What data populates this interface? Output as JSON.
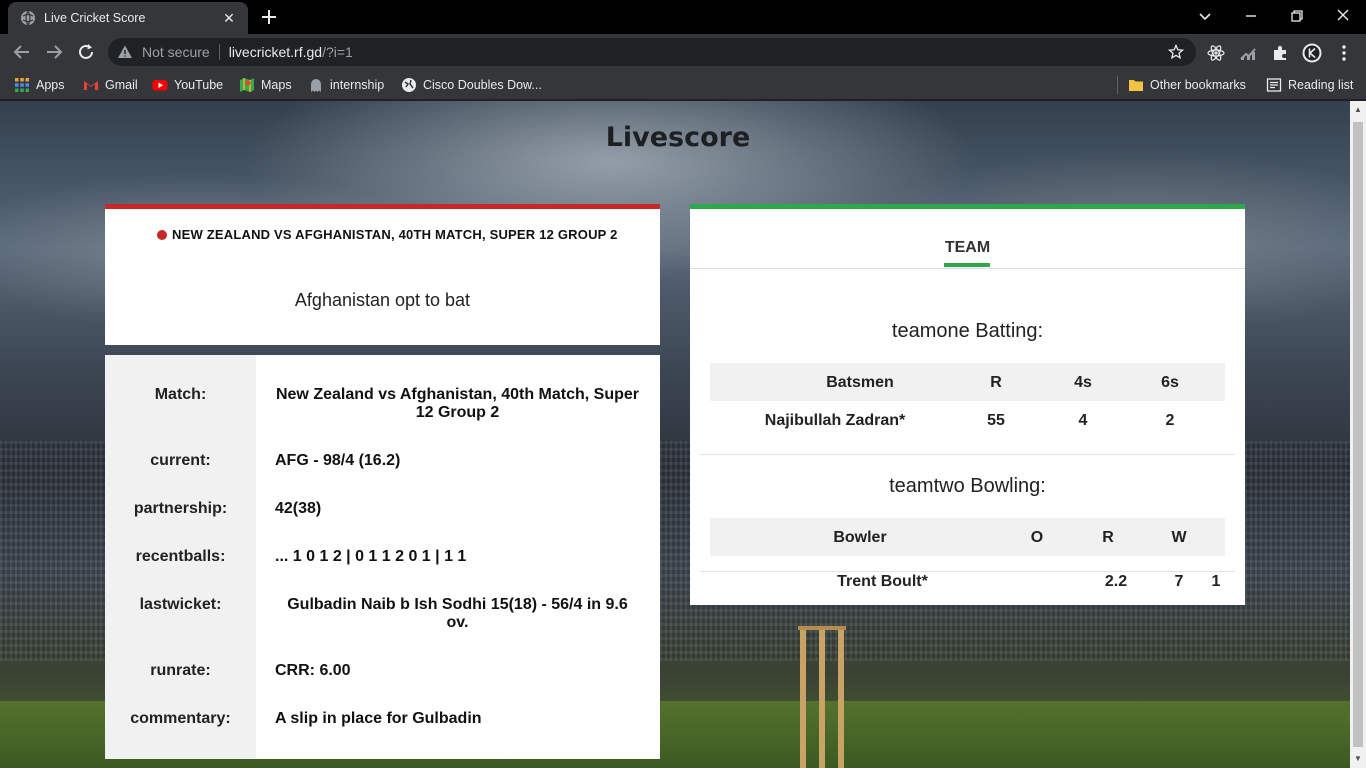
{
  "browser": {
    "tab_title": "Live Cricket Score",
    "security_label": "Not secure",
    "url_host": "livecricket.rf.gd",
    "url_path": "/?i=1",
    "bookmarks": [
      "Apps",
      "Gmail",
      "YouTube",
      "Maps",
      "internship",
      "Cisco Doubles Dow..."
    ],
    "other_bookmarks": "Other bookmarks",
    "reading_list": "Reading list"
  },
  "page": {
    "title": "Livescore"
  },
  "match": {
    "header": "NEW ZEALAND VS AFGHANISTAN, 40TH MATCH, SUPER 12 GROUP 2",
    "toss": "Afghanistan opt to bat",
    "live_color": "#c62828"
  },
  "info": {
    "match_label": "Match:",
    "match_value": "New Zealand vs Afghanistan, 40th Match, Super 12 Group 2",
    "current_label": "current:",
    "current_value": "AFG - 98/4 (16.2)",
    "partnership_label": "partnership:",
    "partnership_value": "42(38)",
    "recentballs_label": "recentballs:",
    "recentballs_value": "... 1 0 1 2 | 0 1 1 2 0 1 | 1 1",
    "lastwicket_label": "lastwicket:",
    "lastwicket_value": "Gulbadin Naib b Ish Sodhi 15(18) - 56/4 in 9.6 ov.",
    "runrate_label": "runrate:",
    "runrate_value": "CRR: 6.00",
    "commentary_label": "commentary:",
    "commentary_value": "A slip in place for Gulbadin"
  },
  "team": {
    "tab_label": "TEAM",
    "accent": "#2ea84a",
    "batting_title": "teamone Batting:",
    "batting_headers": [
      "Batsmen",
      "R",
      "4s",
      "6s"
    ],
    "batting_rows": [
      {
        "name": "Najibullah Zadran*",
        "r": "55",
        "fours": "4",
        "sixes": "2"
      }
    ],
    "bowling_title": "teamtwo Bowling:",
    "bowling_headers": [
      "Bowler",
      "O",
      "R",
      "W"
    ],
    "bowling_rows": [
      {
        "name": "Trent Boult*",
        "o": "2.2",
        "r": "7",
        "w": "1"
      }
    ]
  }
}
